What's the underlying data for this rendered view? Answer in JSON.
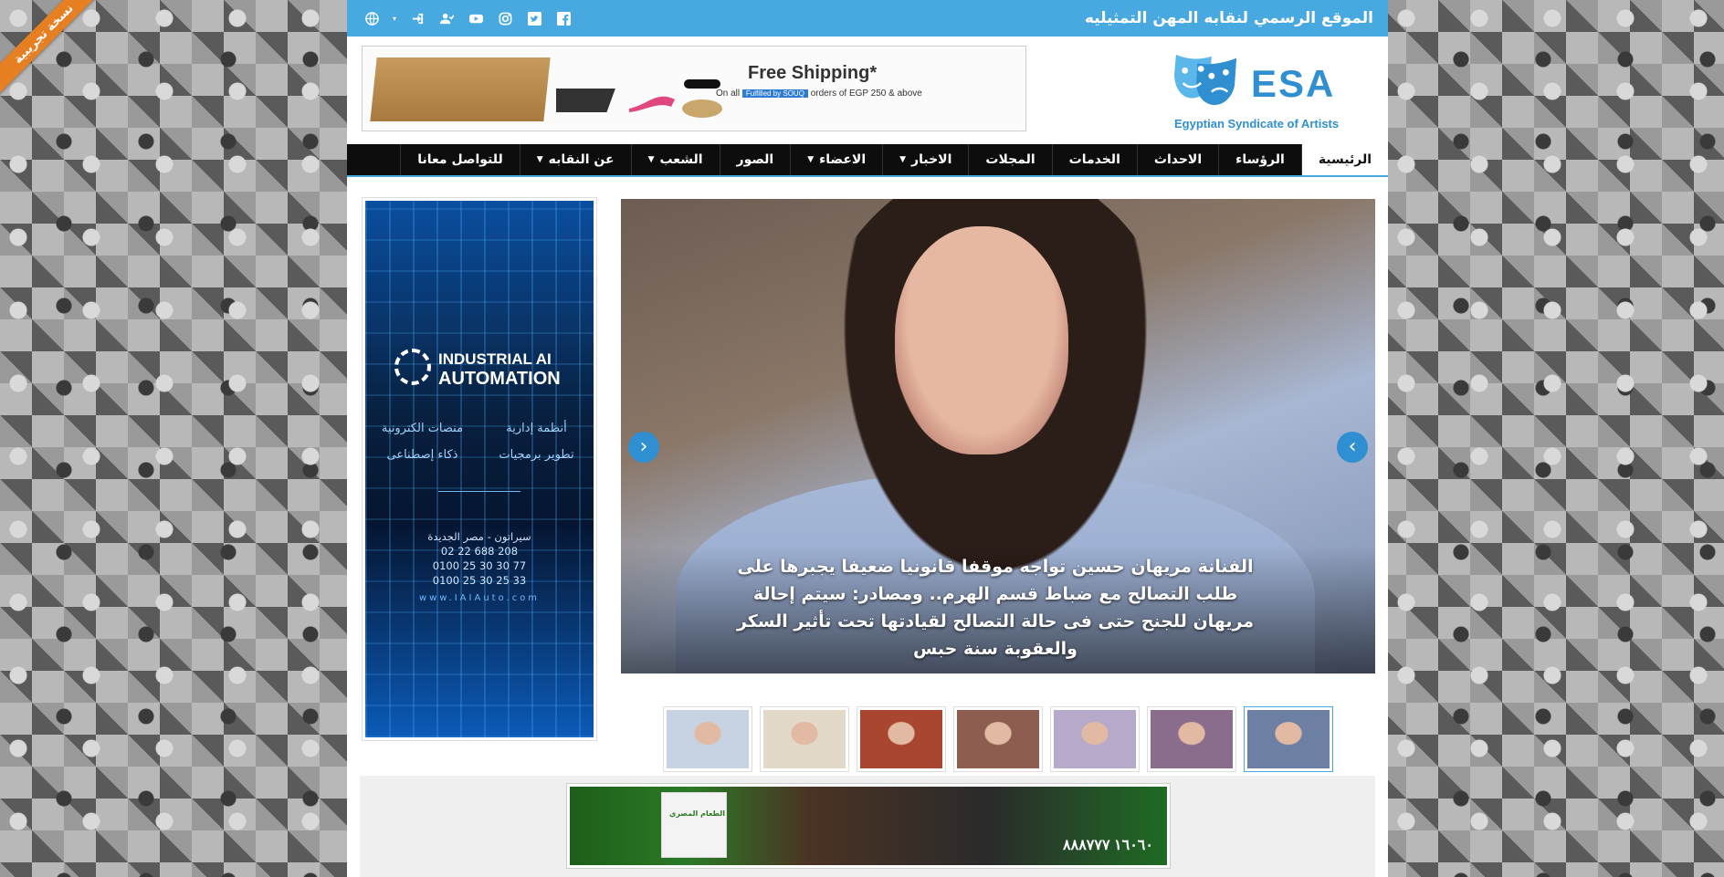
{
  "ribbon": "نسخة تجريبية",
  "topbar": {
    "title": "الموقع الرسمي لنقابه المهن التمثيليه",
    "icons": [
      "facebook-icon",
      "twitter-icon",
      "instagram-icon",
      "youtube-icon",
      "register-icon",
      "login-icon",
      "language-icon"
    ]
  },
  "logo": {
    "text": "ESA",
    "subtitle": "Egyptian Syndicate of Artists"
  },
  "top_ad": {
    "title": "Free Shipping*",
    "sub_prefix": "On all",
    "badge": "Fulfilled by SOUQ",
    "sub_suffix": "orders of EGP 250 & above"
  },
  "nav": [
    {
      "label": "الرئيسية",
      "dropdown": false,
      "active": true
    },
    {
      "label": "الرؤساء",
      "dropdown": false
    },
    {
      "label": "الاحداث",
      "dropdown": false
    },
    {
      "label": "الخدمات",
      "dropdown": false
    },
    {
      "label": "المجلات",
      "dropdown": false
    },
    {
      "label": "الاخبار",
      "dropdown": true
    },
    {
      "label": "الاعضاء",
      "dropdown": true
    },
    {
      "label": "الصور",
      "dropdown": false
    },
    {
      "label": "الشعب",
      "dropdown": true
    },
    {
      "label": "عن النقابه",
      "dropdown": true
    },
    {
      "label": "للتواصل معانا",
      "dropdown": false
    }
  ],
  "slider": {
    "caption": "الفنانة مريهان حسين تواجه موقفا قانونيا ضعيفا يجبرها على طلب التصالح مع ضباط قسم الهرم.. ومصادر: سيتم إحالة مريهان للجنح حتى فى حالة التصالح لقيادتها تحت تأثير السكر والعقوبة سنة حبس",
    "prev": "‹",
    "next": "›"
  },
  "side_ad": {
    "line1": "INDUSTRIAL AI",
    "line2": "AUTOMATION",
    "services": [
      "أنظمة إدارية",
      "منصات الكترونية",
      "تطوير برمجيات",
      "ذكاء إصطناعى"
    ],
    "address": "سيراتون - مصر الجديدة",
    "phones": [
      "02 22 688 208",
      "0100 25 30 30 77",
      "0100 25 30 25 33"
    ],
    "website": "www.IAIAuto.com"
  },
  "thumbs": [
    {
      "color": "#6d7fa3"
    },
    {
      "color": "#8a6d8c"
    },
    {
      "color": "#b7a9c9"
    },
    {
      "color": "#8d5d4f"
    },
    {
      "color": "#a8462f"
    },
    {
      "color": "#e3d9c8"
    },
    {
      "color": "#c7d3e2"
    }
  ],
  "bottom_ad": {
    "bag_label": "الطعام المصري",
    "phone": "١٦٠٦٠ ٨٨٨٧٧٧"
  },
  "colors": {
    "accent": "#47a9e0",
    "nav_bg": "#0d0d0d",
    "ribbon": "#e67e22"
  }
}
